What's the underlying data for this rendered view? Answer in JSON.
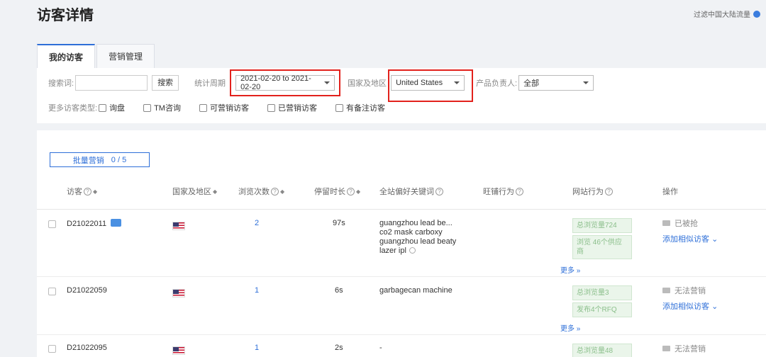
{
  "page": {
    "title": "访客详情",
    "top_right_label": "过滤中国大陆流量"
  },
  "tabs": [
    {
      "label": "我的访客",
      "active": true
    },
    {
      "label": "营销管理",
      "active": false
    }
  ],
  "filters": {
    "search_label": "搜索词:",
    "search_value": "",
    "search_button": "搜索",
    "period_label": "统计周期",
    "period_value": "2021-02-20 to 2021-02-20",
    "country_label": "国家及地区",
    "country_value": "United States",
    "owner_label": "产品负责人:",
    "owner_value": "全部",
    "more_types_label": "更多访客类型:",
    "types": [
      "询盘",
      "TM咨询",
      "可营销访客",
      "已营销访客",
      "有备注访客"
    ]
  },
  "batch": {
    "label": "批量营销",
    "count": "0 / 5"
  },
  "columns": {
    "visitor": "访客",
    "country": "国家及地区",
    "views": "浏览次数",
    "duration": "停留时长",
    "keywords": "全站偏好关键词",
    "shop": "旺铺行为",
    "site": "网站行为",
    "action": "操作"
  },
  "rows": [
    {
      "id": "D21022011",
      "views": "2",
      "duration": "97s",
      "keywords": [
        "guangzhou lead be...",
        "co2 mask carboxy",
        "guangzhou lead beaty",
        "lazer ipl"
      ],
      "site": [
        "总浏览量724",
        "浏览 46个供应商"
      ],
      "more": "更多",
      "status": "已被抢",
      "link": "添加相似访客"
    },
    {
      "id": "D21022059",
      "views": "1",
      "duration": "6s",
      "keywords": [
        "garbagecan machine"
      ],
      "site": [
        "总浏览量3",
        "发布4个RFQ"
      ],
      "more": "更多",
      "status": "无法营销",
      "link": "添加相似访客"
    },
    {
      "id": "D21022095",
      "views": "1",
      "duration": "2s",
      "keywords": [
        "-"
      ],
      "site": [
        "总浏览量48"
      ],
      "more": "",
      "status": "无法营销",
      "link": ""
    }
  ]
}
